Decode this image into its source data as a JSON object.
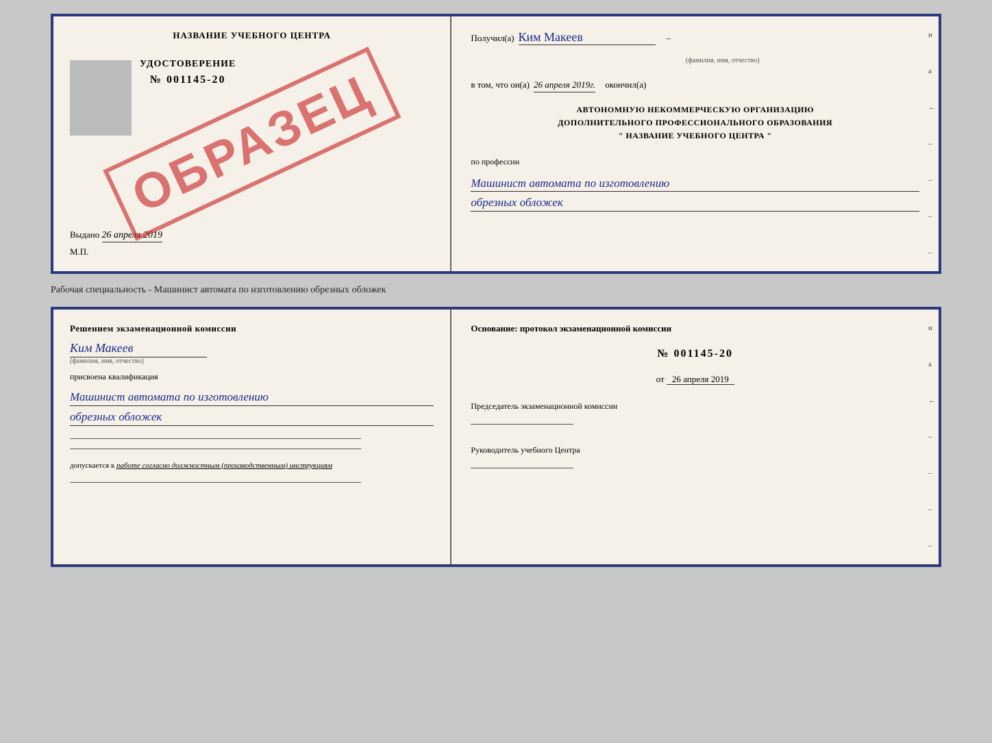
{
  "top_cert": {
    "left": {
      "school_name": "НАЗВАНИЕ УЧЕБНОГО ЦЕНТРА",
      "udostoverenie_label": "УДОСТОВЕРЕНИЕ",
      "cert_number": "№ 001145-20",
      "vydano_label": "Выдано",
      "vydano_date": "26 апреля 2019",
      "mp_label": "М.П."
    },
    "right": {
      "poluchil_label": "Получил(а)",
      "poluchil_value": "Ким Макеев",
      "fio_hint": "(фамилия, имя, отчество)",
      "vtom_label": "в том, что он(а)",
      "vtom_date": "26 апреля 2019г.",
      "okonchil_label": "окончил(а)",
      "org_line1": "АВТОНОМНУЮ НЕКОММЕРЧЕСКУЮ ОРГАНИЗАЦИЮ",
      "org_line2": "ДОПОЛНИТЕЛЬНОГО ПРОФЕССИОНАЛЬНОГО ОБРАЗОВАНИЯ",
      "org_line3": "\"  НАЗВАНИЕ УЧЕБНОГО ЦЕНТРА  \"",
      "po_professii_label": "по профессии",
      "profession_line1": "Машинист автомата по изготовлению",
      "profession_line2": "обрезных обложек",
      "side_marks": [
        "и",
        "а",
        "←",
        "–",
        "–",
        "–",
        "–"
      ]
    },
    "obrazets": "ОБРАЗЕЦ"
  },
  "caption": {
    "text": "Рабочая специальность - Машинист автомата по изготовлению обрезных обложек"
  },
  "bottom_cert": {
    "left": {
      "resheniem_label": "Решением экзаменационной комиссии",
      "name_value": "Ким Макеев",
      "fio_hint": "(фамилия, имя, отчество)",
      "prisvoena_label": "присвоена квалификация",
      "qualification_line1": "Машинист автомата по изготовлению",
      "qualification_line2": "обрезных обложек",
      "допускается_label": "допускается к",
      "допускается_value": "работе согласно должностным (производственным) инструкциям"
    },
    "right": {
      "osnov_label": "Основание: протокол экзаменационной комиссии",
      "number_label": "№ 001145-20",
      "ot_label": "от",
      "ot_date": "26 апреля 2019",
      "predsedatel_label": "Председатель экзаменационной комиссии",
      "rukovoditel_label": "Руководитель учебного Центра",
      "side_marks": [
        "и",
        "а",
        "←",
        "–",
        "–",
        "–",
        "–"
      ]
    }
  }
}
